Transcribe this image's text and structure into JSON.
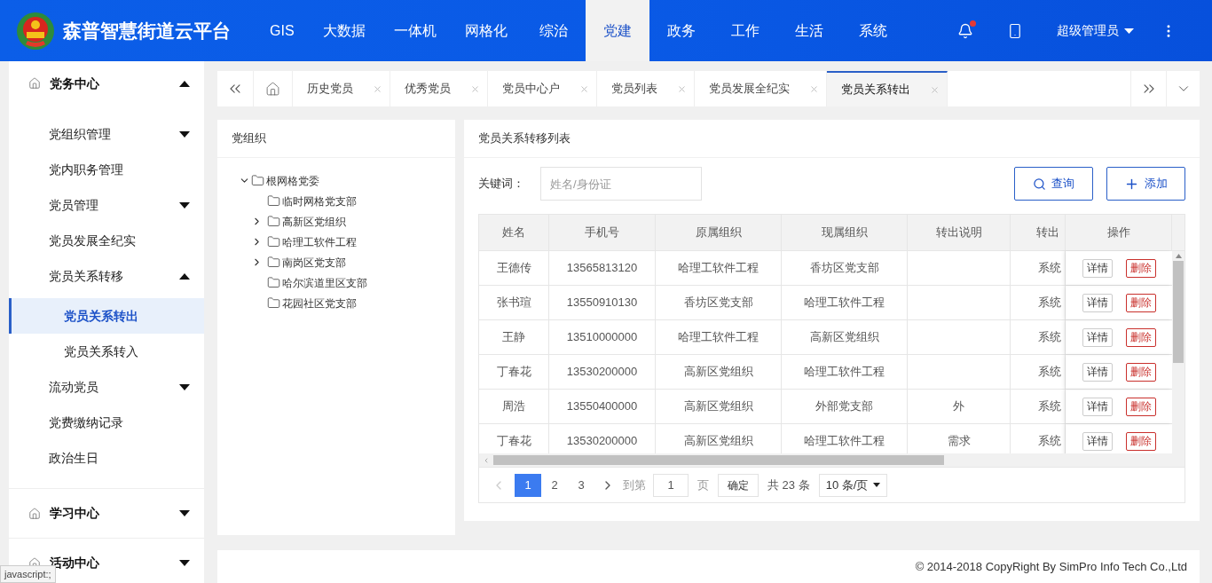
{
  "header": {
    "title": "森普智慧街道云平台",
    "nav": [
      {
        "label": "GIS",
        "selected": false
      },
      {
        "label": "大数据",
        "selected": false
      },
      {
        "label": "一体机",
        "selected": false
      },
      {
        "label": "网格化",
        "selected": false
      },
      {
        "label": "综治",
        "selected": false
      },
      {
        "label": "党建",
        "selected": true
      },
      {
        "label": "政务",
        "selected": false
      },
      {
        "label": "工作",
        "selected": false
      },
      {
        "label": "生活",
        "selected": false
      },
      {
        "label": "系统",
        "selected": false
      }
    ],
    "has_notification": true,
    "user": "超级管理员"
  },
  "sidebar": {
    "sections": [
      {
        "label": "党务中心",
        "expanded": true,
        "items": [
          {
            "kind": "group",
            "label": "党组织管理",
            "expanded": false
          },
          {
            "kind": "link",
            "label": "党内职务管理",
            "selected": false
          },
          {
            "kind": "group",
            "label": "党员管理",
            "expanded": false
          },
          {
            "kind": "link",
            "label": "党员发展全纪实",
            "selected": false
          },
          {
            "kind": "group",
            "label": "党员关系转移",
            "expanded": true,
            "children": [
              {
                "label": "党员关系转出",
                "selected": true
              },
              {
                "label": "党员关系转入",
                "selected": false
              }
            ]
          },
          {
            "kind": "group",
            "label": "流动党员",
            "expanded": false
          },
          {
            "kind": "link",
            "label": "党费缴纳记录",
            "selected": false
          },
          {
            "kind": "link",
            "label": "政治生日",
            "selected": false
          }
        ]
      },
      {
        "label": "学习中心",
        "expanded": false
      },
      {
        "label": "活动中心",
        "expanded": false
      }
    ]
  },
  "tabs": [
    {
      "label": "历史党员",
      "selected": false
    },
    {
      "label": "优秀党员",
      "selected": false
    },
    {
      "label": "党员中心户",
      "selected": false
    },
    {
      "label": "党员列表",
      "selected": false
    },
    {
      "label": "党员发展全纪实",
      "selected": false
    },
    {
      "label": "党员关系转出",
      "selected": true
    }
  ],
  "org_panel": {
    "title": "党组织",
    "tree": [
      {
        "label": "根网格党委",
        "expanded": true,
        "children": [
          {
            "label": "临时网格党支部",
            "kind": "leaf"
          },
          {
            "label": "高新区党组织",
            "kind": "branch",
            "expanded": false
          },
          {
            "label": "哈理工软件工程",
            "kind": "branch",
            "expanded": false
          },
          {
            "label": "南岗区党支部",
            "kind": "branch",
            "expanded": false
          },
          {
            "label": "哈尔滨道里区支部",
            "kind": "leaf"
          },
          {
            "label": "花园社区党支部",
            "kind": "leaf"
          }
        ]
      }
    ]
  },
  "list_panel": {
    "title": "党员关系转移列表",
    "keyword_label": "关键词：",
    "search_placeholder": "姓名/身份证",
    "query_button": "查询",
    "add_button": "添加",
    "table": {
      "columns": [
        "姓名",
        "手机号",
        "原属组织",
        "现属组织",
        "转出说明",
        "转出",
        "操作"
      ],
      "rows": [
        {
          "cells": [
            "王德传",
            "13565813120",
            "哈理工软件工程",
            "香坊区党支部",
            "",
            "系统"
          ],
          "actions": [
            "详情",
            "删除"
          ]
        },
        {
          "cells": [
            "张书瑄",
            "13550910130",
            "香坊区党支部",
            "哈理工软件工程",
            "",
            "系统"
          ],
          "actions": [
            "详情",
            "删除"
          ]
        },
        {
          "cells": [
            "王静",
            "13510000000",
            "哈理工软件工程",
            "高新区党组织",
            "",
            "系统"
          ],
          "actions": [
            "详情",
            "删除"
          ]
        },
        {
          "cells": [
            "丁春花",
            "13530200000",
            "高新区党组织",
            "哈理工软件工程",
            "",
            "系统"
          ],
          "actions": [
            "详情",
            "删除"
          ]
        },
        {
          "cells": [
            "周浩",
            "13550400000",
            "高新区党组织",
            "外部党支部",
            "外",
            "系统"
          ],
          "actions": [
            "详情",
            "删除"
          ]
        },
        {
          "cells": [
            "丁春花",
            "13530200000",
            "高新区党组织",
            "哈理工软件工程",
            "需求",
            "系统"
          ],
          "actions": [
            "详情",
            "删除"
          ]
        }
      ]
    },
    "pagination": {
      "prev_disabled": true,
      "pages": [
        {
          "label": "1",
          "selected": true
        },
        {
          "label": "2",
          "selected": false
        },
        {
          "label": "3",
          "selected": false
        }
      ],
      "goto_label": "到第",
      "goto_value": "1",
      "page_label": "页",
      "confirm": "确定",
      "total": "共 23 条",
      "page_size": "10 条/页"
    }
  },
  "footer": "© 2014-2018 CopyRight By SimPro Info Tech Co.,Ltd",
  "status_bar": "javascript:;"
}
